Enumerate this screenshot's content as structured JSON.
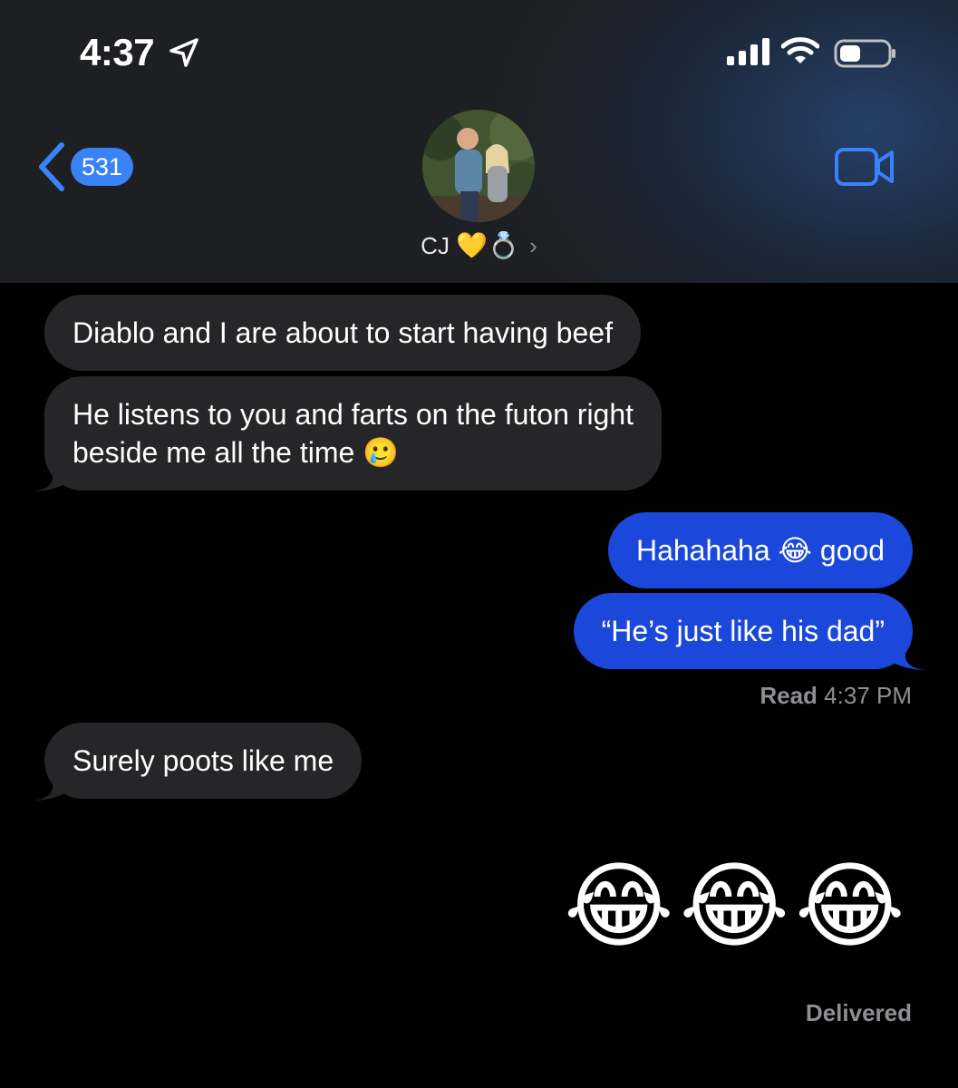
{
  "status_bar": {
    "time": "4:37"
  },
  "nav": {
    "back_count": "531",
    "contact_name": "CJ",
    "contact_emoji": "💛💍",
    "accent_color": "#3a82f7"
  },
  "messages": [
    {
      "direction": "incoming",
      "text": "Diablo and I are about to start having beef"
    },
    {
      "direction": "incoming",
      "text_line1": "He listens to you and farts on the futon right",
      "text_line2": "beside me all the time 🥲"
    },
    {
      "direction": "outgoing",
      "text": "Hahahaha 😂 good"
    },
    {
      "direction": "outgoing",
      "text": "“He’s just like his dad”"
    },
    {
      "direction": "incoming",
      "text": "Surely poots like me"
    },
    {
      "direction": "outgoing",
      "text": "😂😂😂",
      "style": "big-emoji"
    }
  ],
  "receipts": {
    "read_label": "Read",
    "read_time": "4:37 PM",
    "delivered": "Delivered"
  },
  "colors": {
    "incoming_bubble": "#262628",
    "outgoing_bubble": "#1b48da",
    "receipt_text": "#8e8e93"
  }
}
